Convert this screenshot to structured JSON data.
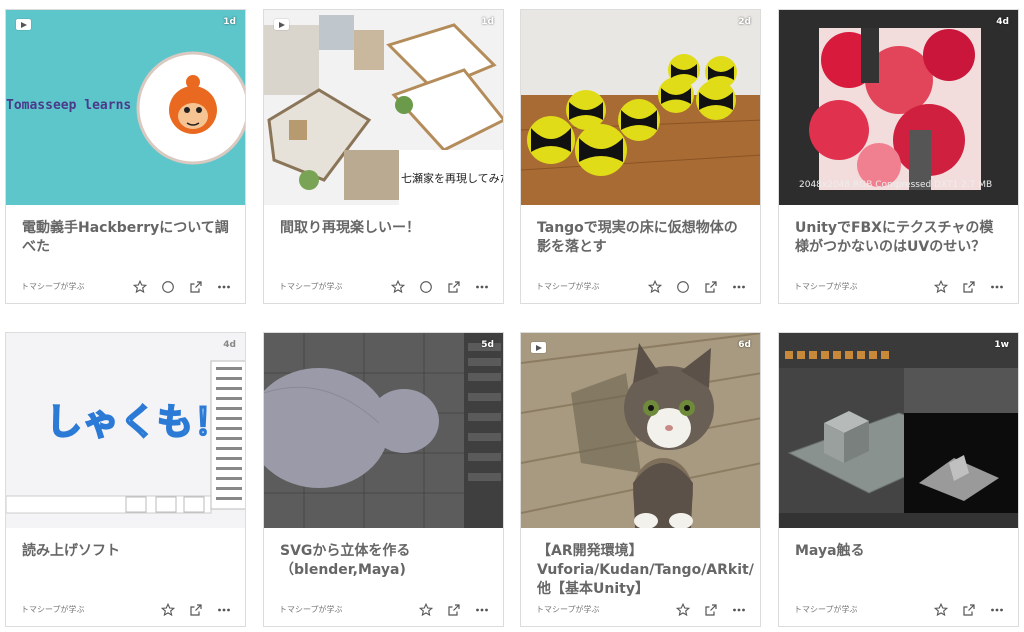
{
  "cards": [
    {
      "title": "電動義手Hackberryについて調べた",
      "author": "トマシープが学ぶ",
      "age": "1d",
      "thumb_text": "Tomasseep learns",
      "actions": [
        "star-icon",
        "circle-icon",
        "external-link-icon",
        "more-icon"
      ]
    },
    {
      "title": "間取り再現楽しいー！",
      "author": "トマシープが学ぶ",
      "age": "1d",
      "thumb_text": "七瀬家を再現してみた",
      "actions": [
        "star-icon",
        "circle-icon",
        "external-link-icon",
        "more-icon"
      ]
    },
    {
      "title": "Tangoで現実の床に仮想物体の影を落とす",
      "author": "トマシープが学ぶ",
      "age": "2d",
      "actions": [
        "star-icon",
        "circle-icon",
        "external-link-icon",
        "more-icon"
      ]
    },
    {
      "title": "UnityでFBXにテクスチャの模様がつかないのはUVのせい？",
      "author": "トマシープが学ぶ",
      "age": "4d",
      "thumb_text": "2048x2048  RGB Compressed DXT1   2.7 MB",
      "actions": [
        "star-icon",
        "external-link-icon",
        "more-icon"
      ]
    },
    {
      "title": "読み上げソフト",
      "author": "トマシープが学ぶ",
      "age": "4d",
      "thumb_text": "しゃくも！",
      "actions": [
        "star-icon",
        "external-link-icon",
        "more-icon"
      ]
    },
    {
      "title": "SVGから立体を作る（blender,Maya)",
      "author": "トマシープが学ぶ",
      "age": "5d",
      "actions": [
        "star-icon",
        "external-link-icon",
        "more-icon"
      ]
    },
    {
      "title": "【AR開発環境】Vuforia/Kudan/Tango/ARkit/他【基本Unity】",
      "author": "トマシープが学ぶ",
      "age": "6d",
      "actions": [
        "star-icon",
        "external-link-icon",
        "more-icon"
      ]
    },
    {
      "title": "Maya触る",
      "author": "トマシープが学ぶ",
      "age": "1w",
      "actions": [
        "star-icon",
        "external-link-icon",
        "more-icon"
      ]
    }
  ],
  "colors": {
    "teal": "#5cc6cb",
    "title": "#666666",
    "border": "#dcdcdc"
  }
}
